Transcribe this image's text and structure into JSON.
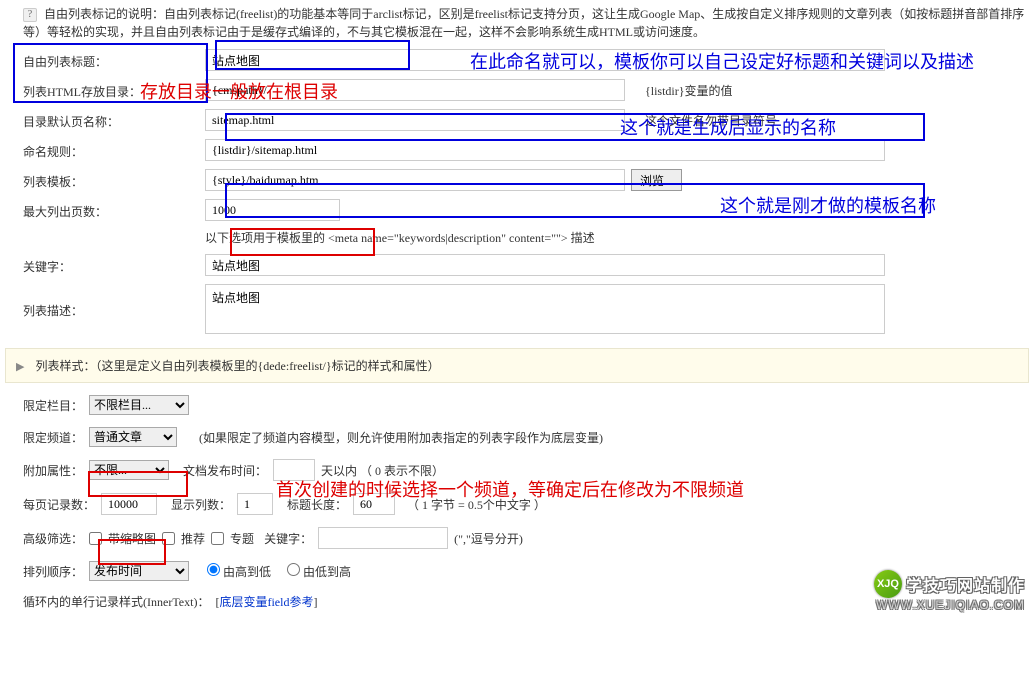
{
  "intro": "自由列表标记的说明：自由列表标记(freelist)的功能基本等同于arclist标记，区别是freelist标记支持分页，这让生成Google Map、生成按自定义排序规则的文章列表（如按标题拼音部首排序等）等轻松的实现，并且自由列表标记由于是缓存式编译的，不与其它模板混在一起，这样不会影响系统生成HTML或访问速度。",
  "labels": {
    "title": "自由列表标题：",
    "htmldir": "列表HTML存放目录：",
    "htmldir_hint": "{listdir}变量的值",
    "defaultpage": "目录默认页名称：",
    "defaultpage_hint": "这个文件名勿带目录符号",
    "naming": "命名规则：",
    "template": "列表模板：",
    "browse": "浏览...",
    "maxpage": "最大列出页数：",
    "meta_hint": "以下选项用于模板里的 <meta name=\"keywords|description\" content=\"\"> 描述",
    "keywords": "关键字：",
    "desc": "列表描述：",
    "style_bar": "列表样式：（这里是定义自由列表模板里的{dede:freelist/}标记的样式和属性）",
    "limit_col": "限定栏目：",
    "limit_chan": "限定频道：",
    "chan_hint": "(如果限定了频道内容模型，则允许使用附加表指定的列表字段作为底层变量)",
    "addprop": "附加属性：",
    "pubtime": "文档发布时间：",
    "pubtime_hint": "天以内 （ 0 表示不限）",
    "perpage": "每页记录数：",
    "dispcol": "显示列数：",
    "titlelen": "标题长度：",
    "titlelen_hint": "（ 1 字节 = 0.5个中文字 ）",
    "advfilter": "高级筛选：",
    "thumb": "带缩略图",
    "recommend": "推荐",
    "special": "专题",
    "kw2": "关键字：",
    "kw2_hint": "(\",\"逗号分开)",
    "order": "排列顺序：",
    "desc2": "由高到低",
    "asc": "由低到高",
    "loop": "循环内的单行记录样式(InnerText)：",
    "fieldref": "底层变量field参考"
  },
  "values": {
    "title": "站点地图",
    "htmldir": "{cmspath}/",
    "defaultpage": "sitemap.html",
    "naming": "{listdir}/sitemap.html",
    "template": "{style}/baidumap.htm",
    "maxpage": "1000",
    "keywords": "站点地图",
    "desc": "站点地图",
    "col_sel": "不限栏目...",
    "chan_sel": "普通文章",
    "addprop_sel": "不限...",
    "pubtime_v": "",
    "perpage": "10000",
    "dispcol": "1",
    "titlelen": "60",
    "kw2_v": "",
    "order_sel": "发布时间"
  },
  "annotations": {
    "a1": "在此命名就可以，模板你可以自己设定好标题和关键词以及描述",
    "a2": "存放目录一般放在根目录",
    "a3": "这个就是生成后显示的名称",
    "a4": "这个就是刚才做的模板名称",
    "a5": "首次创建的时候选择一个频道，等确定后在修改为不限频道"
  },
  "watermark": {
    "logo": "XJQ",
    "line1": "学技巧网站制作",
    "line2": "WWW.XUEJIQIAO.COM"
  }
}
